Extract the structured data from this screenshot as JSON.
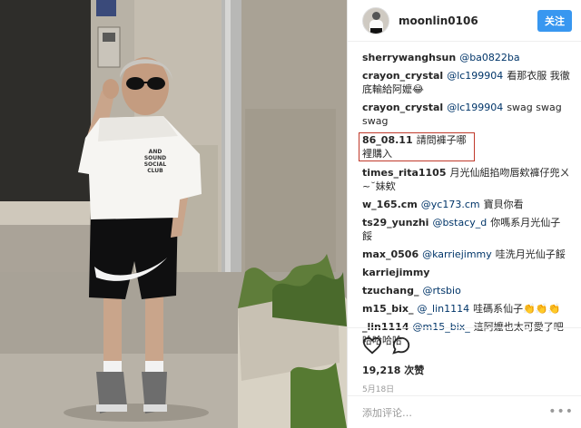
{
  "post": {
    "username": "moonlin0106",
    "follow_label": "关注",
    "likes": "19,218 次赞",
    "date": "5月18日",
    "add_comment_placeholder": "添加评论…",
    "comments": [
      {
        "user": "sherrywanghsun",
        "mention": "@ba0822ba",
        "text": ""
      },
      {
        "user": "crayon_crystal",
        "mention": "@lc199904",
        "text": "看那衣服 我徹底輸給阿嬤😂"
      },
      {
        "user": "crayon_crystal",
        "mention": "@lc199904",
        "text": "swag swag swag"
      },
      {
        "user": "86_08.11",
        "mention": "",
        "text": "請問褲子哪裡購入"
      },
      {
        "user": "times_rita1105",
        "mention": "",
        "text": "月光仙組掐吻唇欸褲仔兜ㄨ~˘妹欸"
      },
      {
        "user": "w_165.cm",
        "mention": "@yc173.cm",
        "text": "寶貝你看"
      },
      {
        "user": "ts29_yunzhi",
        "mention": "@bstacy_d",
        "text": "你嗎系月光仙子餒"
      },
      {
        "user": "max_0506",
        "mention": "@karriejimmy",
        "text": "哇洗月光仙子餒"
      },
      {
        "user": "karriejimmy",
        "mention": "",
        "text": ""
      },
      {
        "user": "tzuchang_",
        "mention": "@rtsbio",
        "text": ""
      },
      {
        "user": "m15_bix_",
        "mention": "@_lin1114",
        "text": "哇碼系仙子👏👏👏"
      },
      {
        "user": "_lin1114",
        "mention": "@m15_bix_",
        "text": "這阿嬤也太可愛了吧哈哈哈哈"
      }
    ]
  },
  "photo": {
    "shirt_print": "AND SOUND SOCIAL CLUB"
  },
  "colors": {
    "accent": "#3897f0",
    "highlight_box": "#c0392b"
  },
  "icons": [
    "heart-icon",
    "comment-icon",
    "more-icon"
  ]
}
